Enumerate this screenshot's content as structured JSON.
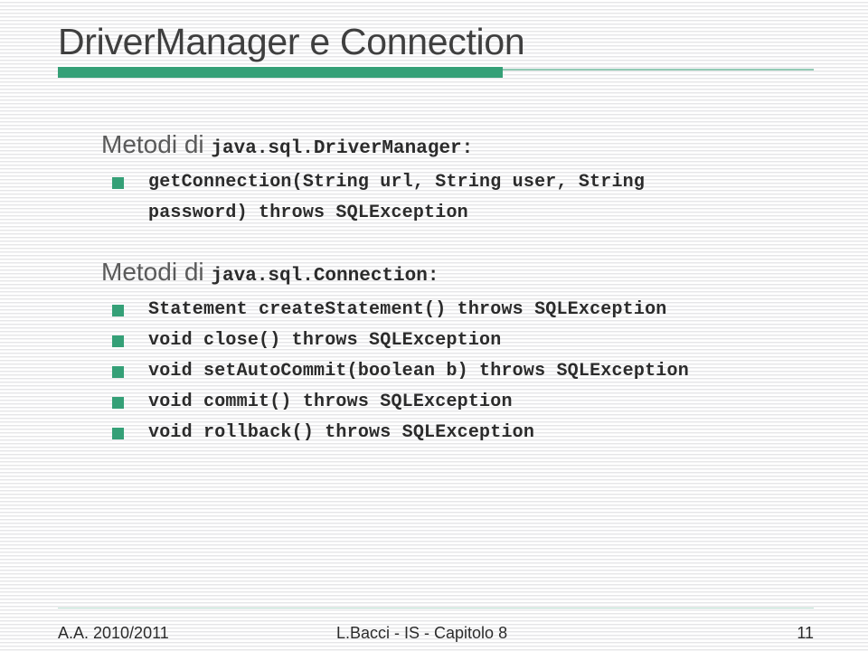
{
  "theme": {
    "accent_green": "#35a077",
    "title_color": "#3f3f3f",
    "heading_color": "#5a5a5a",
    "code_color": "#2b2b2b",
    "background": "#ffffff"
  },
  "title": "DriverManager e Connection",
  "sections": [
    {
      "id": "drivermanager",
      "heading_prefix": "Metodi di ",
      "heading_code": "java.sql.DriverManager",
      "heading_colon": ":",
      "bullets": [
        "getConnection(String url, String user, String\npassword) throws SQLException"
      ]
    },
    {
      "id": "connection",
      "heading_prefix": "Metodi di ",
      "heading_code": "java.sql.Connection",
      "heading_colon": ":",
      "bullets": [
        "Statement createStatement() throws SQLException",
        "void close() throws SQLException",
        "void setAutoCommit(boolean b) throws SQLException",
        "void commit() throws SQLException",
        "void rollback() throws SQLException"
      ]
    }
  ],
  "footer": {
    "left": "A.A. 2010/2011",
    "center": "L.Bacci - IS - Capitolo 8",
    "right": "11"
  }
}
